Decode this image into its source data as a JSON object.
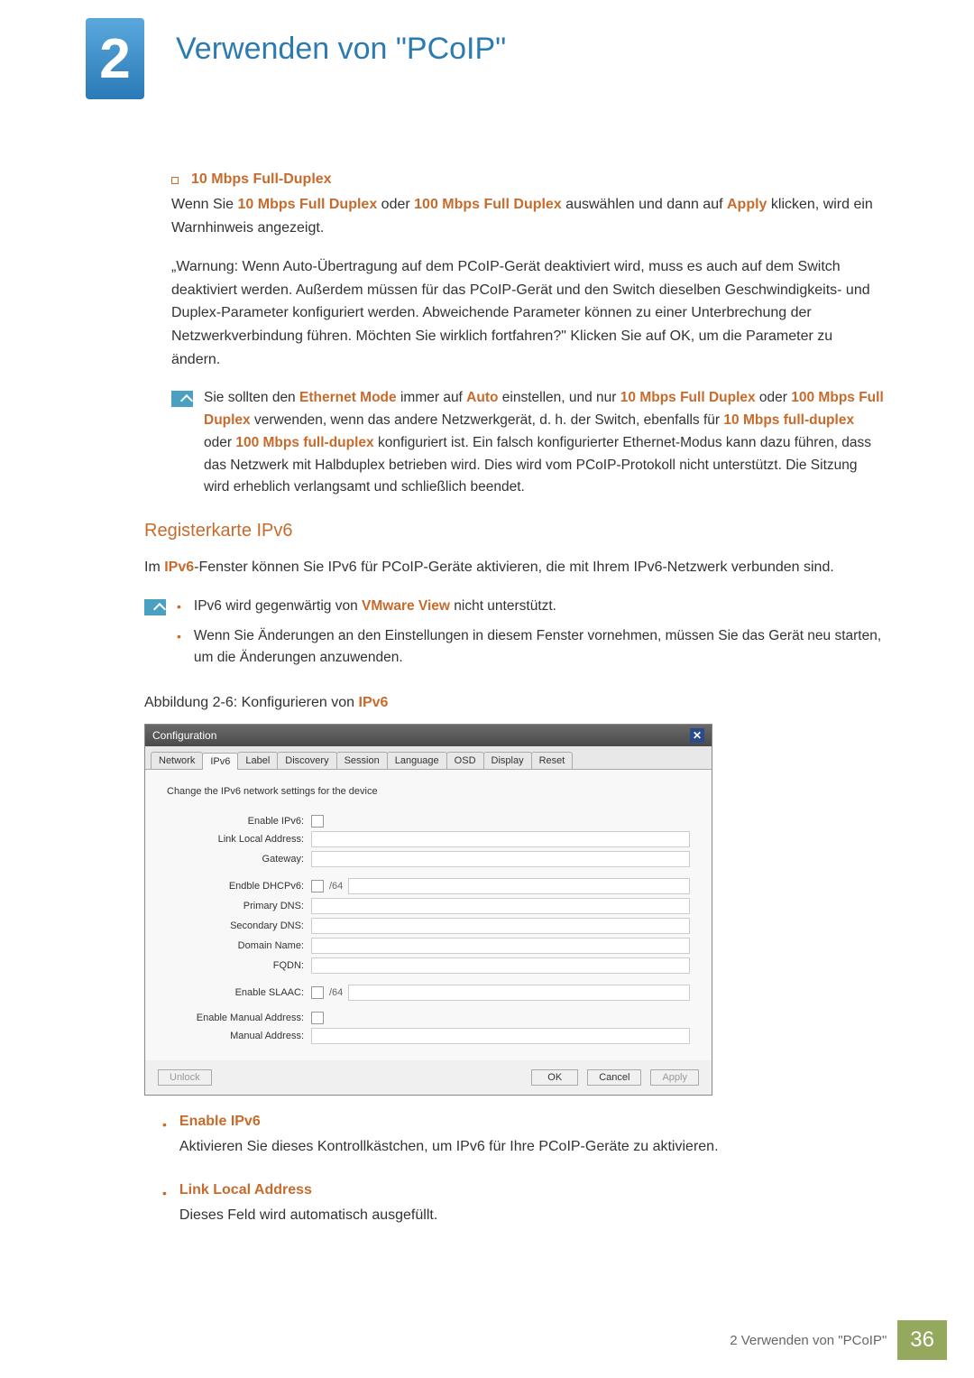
{
  "chapter": {
    "number": "2",
    "title": "Verwenden von \"PCoIP\""
  },
  "sec1": {
    "heading": "10 Mbps Full-Duplex",
    "p1_a": "Wenn Sie ",
    "p1_b": "10 Mbps Full Duplex",
    "p1_c": " oder ",
    "p1_d": "100 Mbps Full Duplex",
    "p1_e": " auswählen und dann auf ",
    "p1_f": "Apply",
    "p1_g": " klicken, wird ein Warnhinweis angezeigt.",
    "p2": "„Warnung: Wenn Auto-Übertragung auf dem PCoIP-Gerät deaktiviert wird, muss es auch auf dem Switch deaktiviert werden. Außerdem müssen für das PCoIP-Gerät und den Switch dieselben Geschwindigkeits- und Duplex-Parameter konfiguriert werden. Abweichende Parameter können zu einer Unterbrechung der Netzwerkverbindung führen. Möchten Sie wirklich fortfahren?\" Klicken Sie auf OK, um die Parameter zu ändern.",
    "note_a": "Sie sollten den ",
    "note_b": "Ethernet Mode",
    "note_c": " immer auf ",
    "note_d": "Auto",
    "note_e": " einstellen, und nur ",
    "note_f": "10 Mbps Full Duplex",
    "note_g": " oder ",
    "note_h": "100 Mbps Full Duplex",
    "note_i": " verwenden, wenn das andere Netzwerkgerät, d. h. der Switch, ebenfalls für ",
    "note_j": "10 Mbps full-duplex",
    "note_k": " oder ",
    "note_l": "100 Mbps full-duplex",
    "note_m": " konfiguriert ist. Ein falsch konfigurierter Ethernet-Modus kann dazu führen, dass das Netzwerk mit Halbduplex betrieben wird. Dies wird vom PCoIP-Protokoll nicht unterstützt. Die Sitzung wird erheblich verlangsamt und schließlich beendet."
  },
  "sec2": {
    "heading": "Registerkarte IPv6",
    "p1_a": "Im ",
    "p1_b": "IPv6",
    "p1_c": "-Fenster können Sie IPv6 für PCoIP-Geräte aktivieren, die mit Ihrem IPv6-Netzwerk verbunden sind.",
    "bullet1_a": "IPv6 wird gegenwärtig von ",
    "bullet1_b": "VMware View",
    "bullet1_c": " nicht unterstützt.",
    "bullet2": "Wenn Sie Änderungen an den Einstellungen in diesem Fenster vornehmen, müssen Sie das Gerät neu starten, um die Änderungen anzuwenden.",
    "caption_a": "Abbildung 2-6: Konfigurieren von ",
    "caption_b": "IPv6"
  },
  "dialog": {
    "title": "Configuration",
    "tabs": [
      "Network",
      "IPv6",
      "Label",
      "Discovery",
      "Session",
      "Language",
      "OSD",
      "Display",
      "Reset"
    ],
    "desc": "Change the IPv6 network settings for the device",
    "labels": {
      "enable_ipv6": "Enable IPv6:",
      "link_local": "Link Local Address:",
      "gateway": "Gateway:",
      "enable_dhcp": "Endble DHCPv6:",
      "primary_dns": "Primary DNS:",
      "secondary_dns": "Secondary DNS:",
      "domain_name": "Domain Name:",
      "fqdn": "FQDN:",
      "enable_slaac": "Enable SLAAC:",
      "enable_manual": "Enable Manual Address:",
      "manual_addr": "Manual Address:"
    },
    "suffix64": "/64",
    "btn_unlock": "Unlock",
    "btn_ok": "OK",
    "btn_cancel": "Cancel",
    "btn_apply": "Apply"
  },
  "sec3": {
    "h1": "Enable IPv6",
    "p1": "Aktivieren Sie dieses Kontrollkästchen, um IPv6 für Ihre PCoIP-Geräte zu aktivieren.",
    "h2": "Link Local Address",
    "p2": "Dieses Feld wird automatisch ausgefüllt."
  },
  "footer": {
    "text": "2 Verwenden von \"PCoIP\"",
    "page": "36"
  }
}
